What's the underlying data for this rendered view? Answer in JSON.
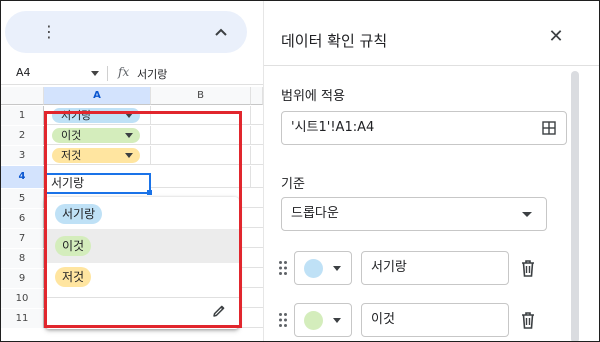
{
  "sheet": {
    "namebox": "A4",
    "fx_icon": "fx",
    "formula_value": "서기랑",
    "columns": [
      "A",
      "B"
    ],
    "rows": [
      "1",
      "2",
      "3",
      "4",
      "5",
      "6",
      "7",
      "8",
      "9",
      "10",
      "11"
    ],
    "chips": [
      {
        "label": "서기랑",
        "color": "#bfe1f6"
      },
      {
        "label": "이것",
        "color": "#d4edbc"
      },
      {
        "label": "저것",
        "color": "#ffe5a0"
      }
    ],
    "editing_value": "서기랑",
    "dropdown_options": [
      {
        "label": "서기랑",
        "color": "#bfe1f6"
      },
      {
        "label": "이것",
        "color": "#d4edbc"
      },
      {
        "label": "저것",
        "color": "#ffe5a0"
      }
    ],
    "icons": {
      "menu": "kebab-icon",
      "collapse": "chevron-up-icon",
      "edit": "pencil-icon"
    }
  },
  "panel": {
    "title": "데이터 확인 규칙",
    "range_label": "범위에 적용",
    "range_value": "'시트1'!A1:A4",
    "criteria_label": "기준",
    "criteria_value": "드롭다운",
    "options": [
      {
        "value": "서기랑",
        "color": "#bfe1f6"
      },
      {
        "value": "이것",
        "color": "#d4edbc"
      }
    ],
    "icons": {
      "close": "close-icon",
      "range": "grid-icon",
      "drag": "drag-icon",
      "delete": "trash-icon"
    }
  },
  "colors": {
    "highlight_box": "#e1262d",
    "selection": "#1a73e8",
    "header_active": "#d3e3fd"
  }
}
